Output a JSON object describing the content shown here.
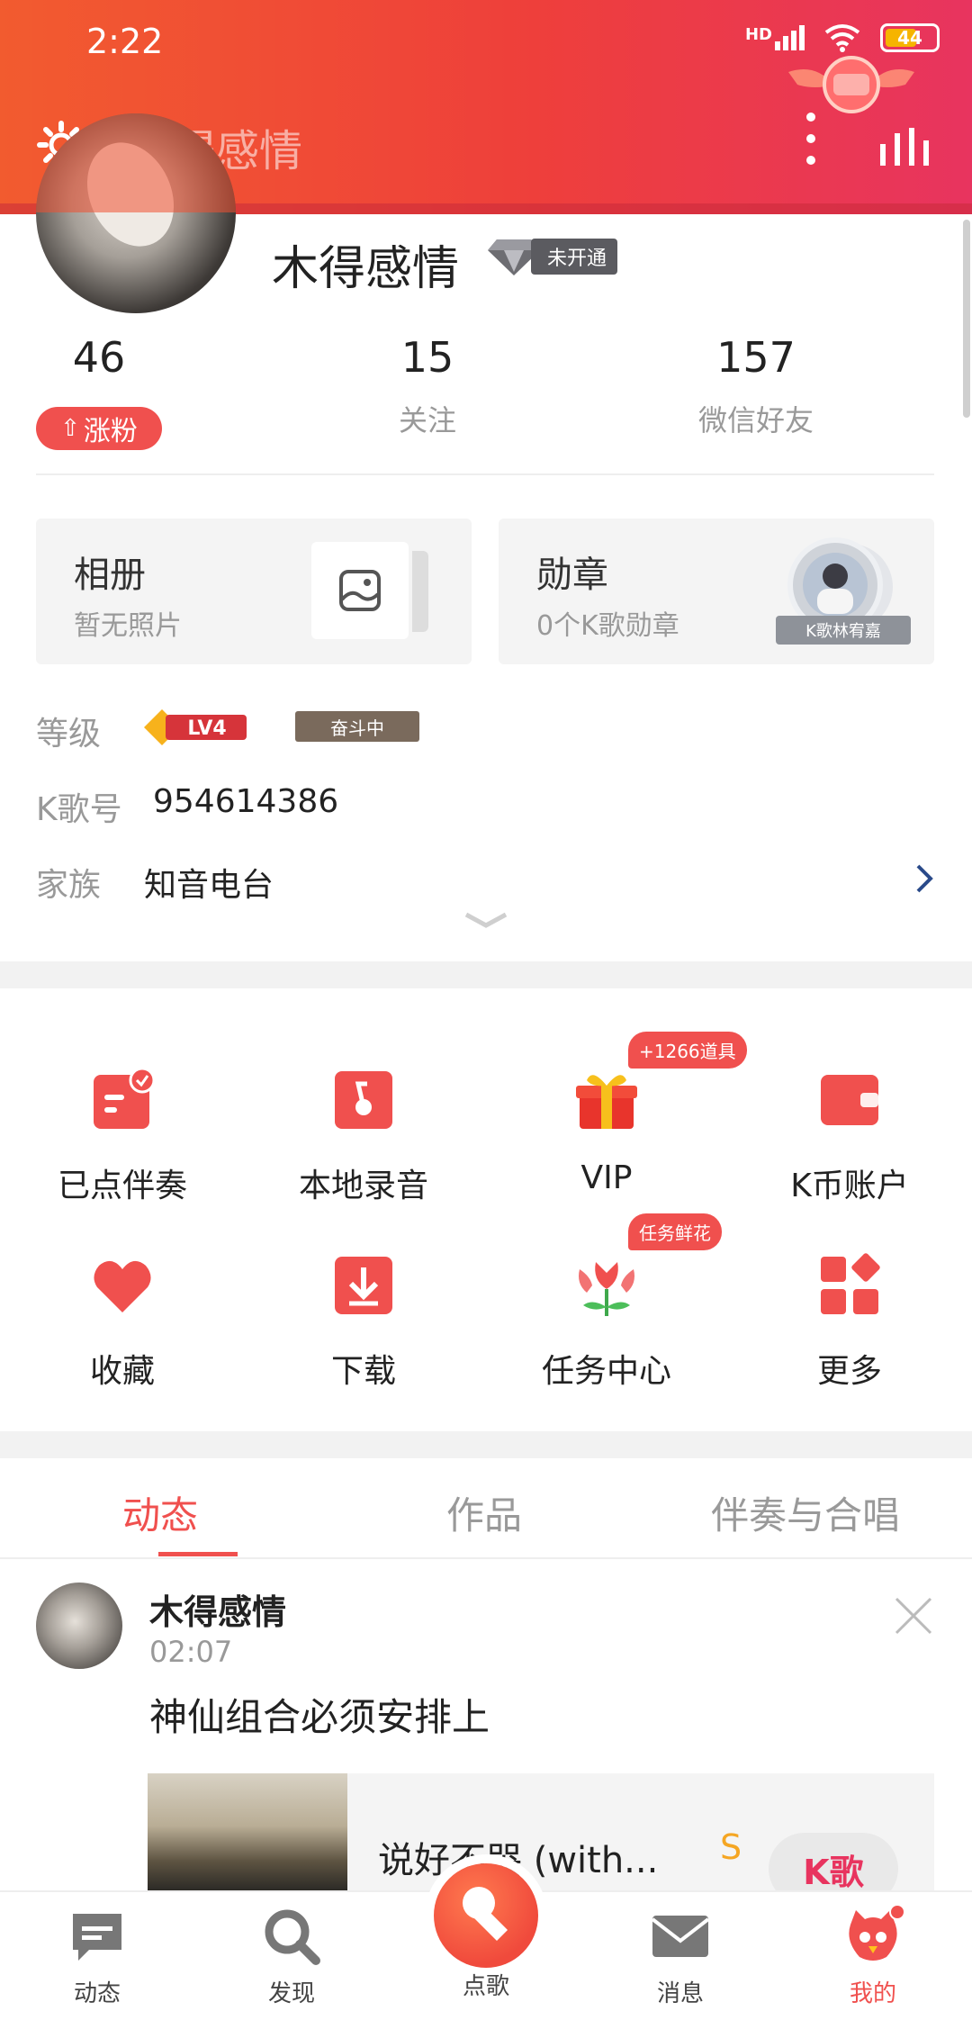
{
  "status_bar": {
    "time": "2:22",
    "network": "HD",
    "battery": "44"
  },
  "header": {
    "title": "木得感情"
  },
  "profile": {
    "name": "木得感情",
    "vip_badge": "未开通",
    "stats": [
      {
        "value": "46",
        "label": "涨粉"
      },
      {
        "value": "15",
        "label": "关注"
      },
      {
        "value": "157",
        "label": "微信好友"
      }
    ],
    "fans_tag": "涨粉"
  },
  "cards": {
    "album": {
      "title": "相册",
      "subtitle": "暂无照片"
    },
    "medal": {
      "title": "勋章",
      "subtitle": "0个K歌勋章",
      "medal_caption": "K歌林宥嘉"
    }
  },
  "info": {
    "level_label": "等级",
    "level_badge": "LV4",
    "level_status": "奋斗中",
    "kid_label": "K歌号",
    "kid_value": "954614386",
    "family_label": "家族",
    "family_value": "知音电台"
  },
  "grid": [
    {
      "label": "已点伴奏",
      "icon": "accompaniment-icon"
    },
    {
      "label": "本地录音",
      "icon": "local-record-icon"
    },
    {
      "label": "VIP",
      "icon": "gift-box-icon",
      "pill": "+1266道具"
    },
    {
      "label": "K币账户",
      "icon": "wallet-icon"
    },
    {
      "label": "收藏",
      "icon": "heart-icon"
    },
    {
      "label": "下载",
      "icon": "download-icon"
    },
    {
      "label": "任务中心",
      "icon": "flower-icon",
      "pill": "任务鲜花"
    },
    {
      "label": "更多",
      "icon": "more-grid-icon"
    }
  ],
  "tabs": [
    {
      "label": "动态",
      "active": true
    },
    {
      "label": "作品",
      "active": false
    },
    {
      "label": "伴奏与合唱",
      "active": false
    }
  ],
  "post": {
    "author": "木得感情",
    "time": "02:07",
    "text": "神仙组合必须安排上",
    "song_title": "说好不哭 (with...",
    "song_grade": "S",
    "song_button": "K歌"
  },
  "bottom_nav": [
    {
      "label": "动态",
      "icon": "feed-icon"
    },
    {
      "label": "发现",
      "icon": "discover-icon"
    },
    {
      "label": "点歌",
      "icon": "microphone-icon"
    },
    {
      "label": "消息",
      "icon": "message-icon"
    },
    {
      "label": "我的",
      "icon": "profile-icon"
    }
  ],
  "colors": {
    "accent": "#f0504e",
    "header_start": "#f25b2f",
    "header_end": "#e8345f"
  }
}
